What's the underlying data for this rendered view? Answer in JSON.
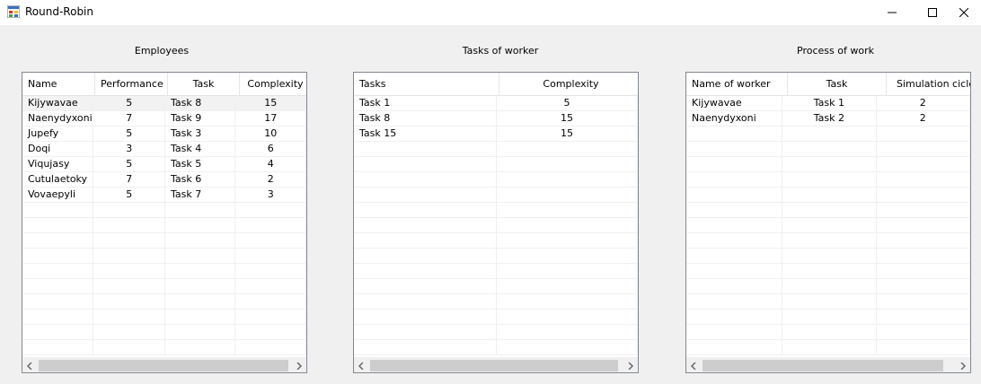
{
  "window": {
    "title": "Round-Robin"
  },
  "employees": {
    "label": "Employees",
    "columns": [
      "Name",
      "Performance",
      "Task",
      "Complexity"
    ],
    "rows": [
      [
        "Kijywavae",
        "5",
        "Task 8",
        "15"
      ],
      [
        "Naenydyxoni",
        "7",
        "Task 9",
        "17"
      ],
      [
        "Jupefy",
        "5",
        "Task 3",
        "10"
      ],
      [
        "Doqi",
        "3",
        "Task 4",
        "6"
      ],
      [
        "Viqujasy",
        "5",
        "Task 5",
        "4"
      ],
      [
        "Cutulaetoky",
        "7",
        "Task 6",
        "2"
      ],
      [
        "Vovaepyli",
        "5",
        "Task 7",
        "3"
      ]
    ]
  },
  "tasks_of_worker": {
    "label": "Tasks of worker",
    "columns": [
      "Tasks",
      "Complexity"
    ],
    "rows": [
      [
        "Task 1",
        "5"
      ],
      [
        "Task 8",
        "15"
      ],
      [
        "Task 15",
        "15"
      ]
    ]
  },
  "process_of_work": {
    "label": "Process of work",
    "columns": [
      "Name of worker",
      "Task",
      "Simulation cicle"
    ],
    "rows": [
      [
        "Kijywavae",
        "Task 1",
        "2"
      ],
      [
        "Naenydyxoni",
        "Task 2",
        "2"
      ]
    ]
  },
  "icons": {
    "app": "app-icon",
    "minimize": "minimize-icon",
    "maximize": "maximize-icon",
    "close": "close-icon",
    "scroll_left": "chevron-left-icon",
    "scroll_right": "chevron-right-icon"
  }
}
